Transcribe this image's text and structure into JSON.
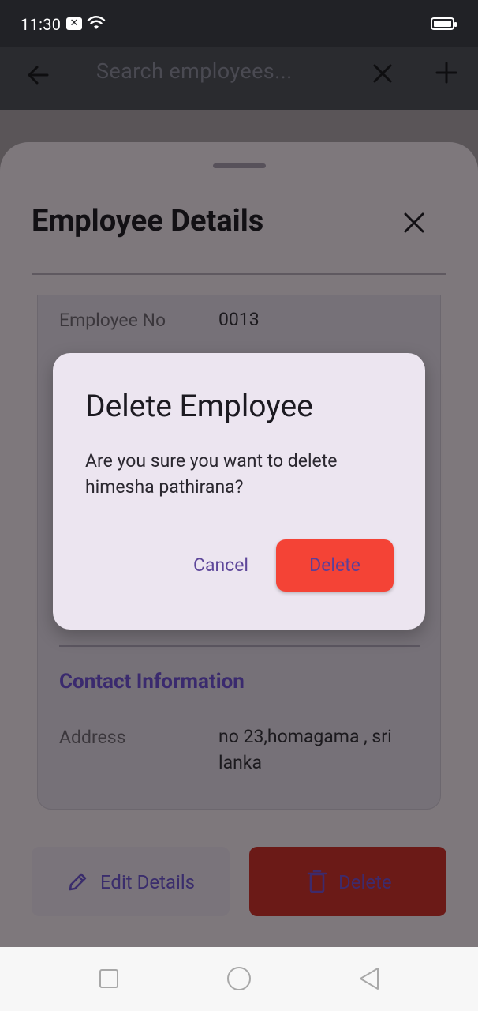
{
  "status_bar": {
    "time": "11:30",
    "notification_icon": "close-box-icon",
    "wifi_icon": "wifi-icon",
    "battery_icon": "battery-full-icon"
  },
  "app_bar": {
    "back_icon": "arrow-left-icon",
    "search_placeholder": "Search employees...",
    "clear_icon": "close-icon",
    "add_icon": "plus-icon"
  },
  "sheet": {
    "title": "Employee Details",
    "close_icon": "close-icon",
    "fields": [
      {
        "label": "Employee No",
        "value": "0013"
      }
    ],
    "contact_section_title": "Contact Information",
    "contact_fields": [
      {
        "label": "Address",
        "value": "no 23,homagama , sri lanka"
      }
    ],
    "actions": {
      "edit_label": "Edit Details",
      "edit_icon": "pencil-icon",
      "delete_label": "Delete",
      "delete_icon": "trash-icon"
    }
  },
  "dialog": {
    "title": "Delete Employee",
    "message": "Are you sure you want to delete himesha pathirana?",
    "cancel_label": "Cancel",
    "confirm_label": "Delete"
  },
  "colors": {
    "confirm_button": "#f44336",
    "dialog_background": "#ece5f0",
    "accent_text": "#5e479a"
  },
  "nav_bar": {
    "recent_icon": "square-icon",
    "home_icon": "circle-icon",
    "back_icon": "triangle-back-icon"
  }
}
